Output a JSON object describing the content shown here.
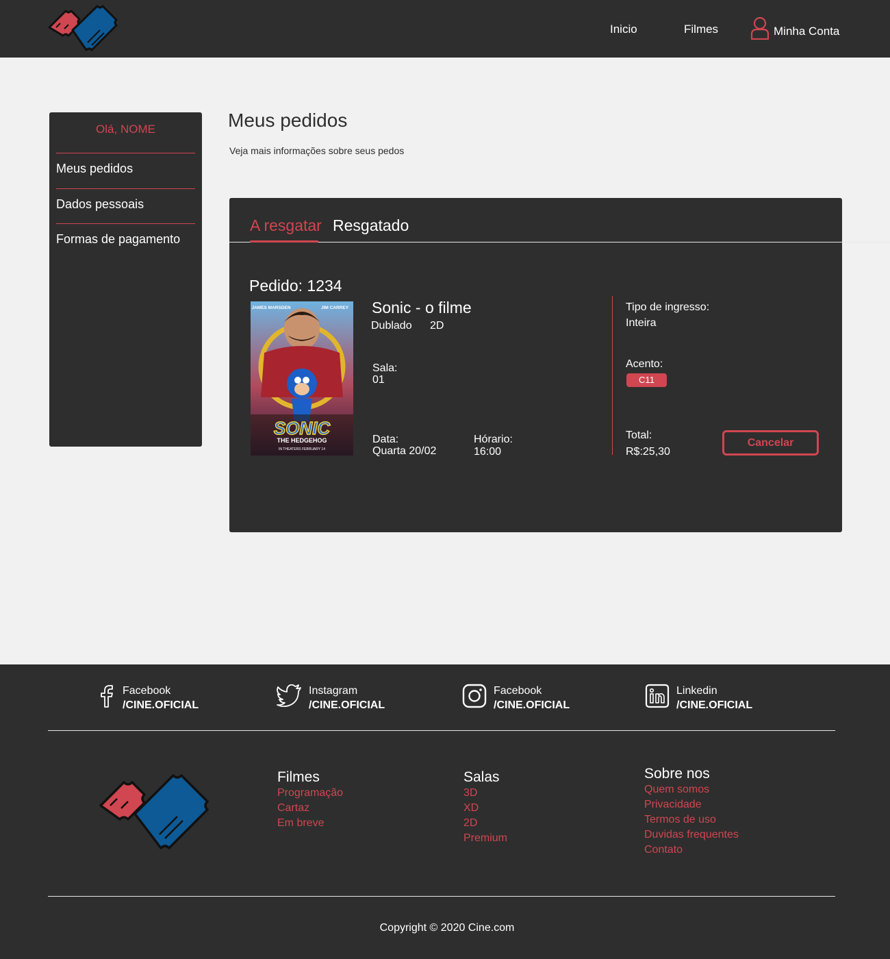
{
  "colors": {
    "accent": "#d04651",
    "dark": "#2e2e2e",
    "light_bg": "#f1f1f1",
    "ticket_blue": "#0d5a96"
  },
  "nav": {
    "inicio": "Inicio",
    "filmes": "Filmes",
    "account": "Minha Conta"
  },
  "sidebar": {
    "greeting": "Olá, NOME",
    "items": [
      "Meus pedidos",
      "Dados pessoais",
      "Formas de pagamento"
    ]
  },
  "main": {
    "title": "Meus pedidos",
    "subtitle": "Veja mais informações sobre seus pedos",
    "tabs": {
      "active": "A resgatar",
      "other": "Resgatado"
    }
  },
  "order": {
    "title": "Pedido: 1234",
    "movie_title": "Sonic - o filme",
    "language": "Dublado",
    "format": "2D",
    "room_label": "Sala:",
    "room_value": "01",
    "date_label": "Data:",
    "date_value": "Quarta 20/02",
    "time_label": "Hórario:",
    "time_value": "16:00",
    "ticket_type_label": "Tipo de ingresso:",
    "ticket_type_value": "Inteira",
    "seat_label": "Acento:",
    "seat_value": "C11",
    "total_label": "Total:",
    "total_value": "R$:25,30",
    "cancel": "Cancelar",
    "poster": {
      "actor_left": "JAMES MARSDEN",
      "actor_right": "JIM CARREY",
      "title": "SONIC",
      "subtitle": "THE HEDGEHOG",
      "release": "IN THEATERS FEBRUARY 14"
    }
  },
  "footer": {
    "social": [
      {
        "network": "Facebook",
        "handle": "/CINE.OFICIAL",
        "icon": "facebook-icon"
      },
      {
        "network": "Instagram",
        "handle": "/CINE.OFICIAL",
        "icon": "twitter-icon"
      },
      {
        "network": "Facebook",
        "handle": "/CINE.OFICIAL",
        "icon": "instagram-icon"
      },
      {
        "network": "Linkedin",
        "handle": "/CINE.OFICIAL",
        "icon": "linkedin-icon"
      }
    ],
    "columns": [
      {
        "heading": "Filmes",
        "links": [
          "Programação",
          "Cartaz",
          "Em breve"
        ]
      },
      {
        "heading": "Salas",
        "links": [
          "3D",
          "XD",
          "2D",
          "Premium"
        ]
      },
      {
        "heading": "Sobre nos",
        "links": [
          "Quem somos",
          "Privacidade",
          "Termos de uso",
          "Duvidas frequentes",
          "Contato"
        ]
      }
    ],
    "copyright": "Copyright © 2020 Cine.com"
  }
}
